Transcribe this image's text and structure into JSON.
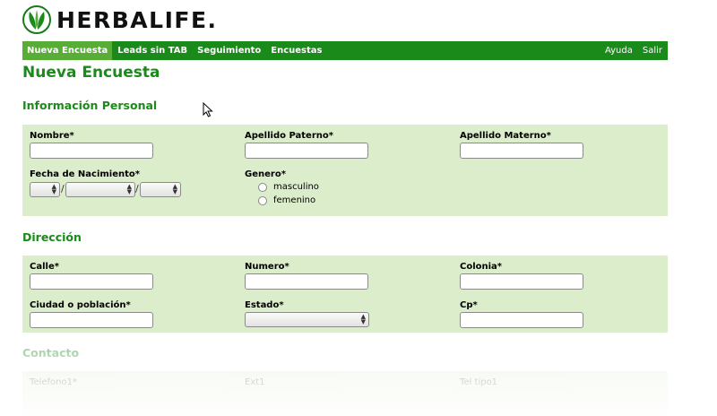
{
  "brand": {
    "name": "HERBALIFE.",
    "accent": "#1a8a1a",
    "nav_active": "#58ad37",
    "panel_bg": "#dcedcc"
  },
  "nav": {
    "items": [
      "Nueva Encuesta",
      "Leads sin TAB",
      "Seguimiento",
      "Encuestas"
    ],
    "right": [
      "Ayuda",
      "Salir"
    ]
  },
  "page_title": "Nueva Encuesta",
  "personal": {
    "title": "Información Personal",
    "nombre": "Nombre*",
    "apellido_paterno": "Apellido Paterno*",
    "apellido_materno": "Apellido Materno*",
    "fecha": "Fecha de Nacimiento*",
    "genero": "Genero*",
    "masculino": "masculino",
    "femenino": "femenino",
    "date_sep": "/"
  },
  "direccion": {
    "title": "Dirección",
    "calle": "Calle*",
    "numero": "Numero*",
    "colonia": "Colonia*",
    "ciudad": "Ciudad o población*",
    "estado": "Estado*",
    "cp": "Cp*"
  },
  "contacto": {
    "title": "Contacto",
    "telefono": "Telefono1*",
    "ext": "Ext1",
    "tel_tipo": "Tel tipo1"
  }
}
